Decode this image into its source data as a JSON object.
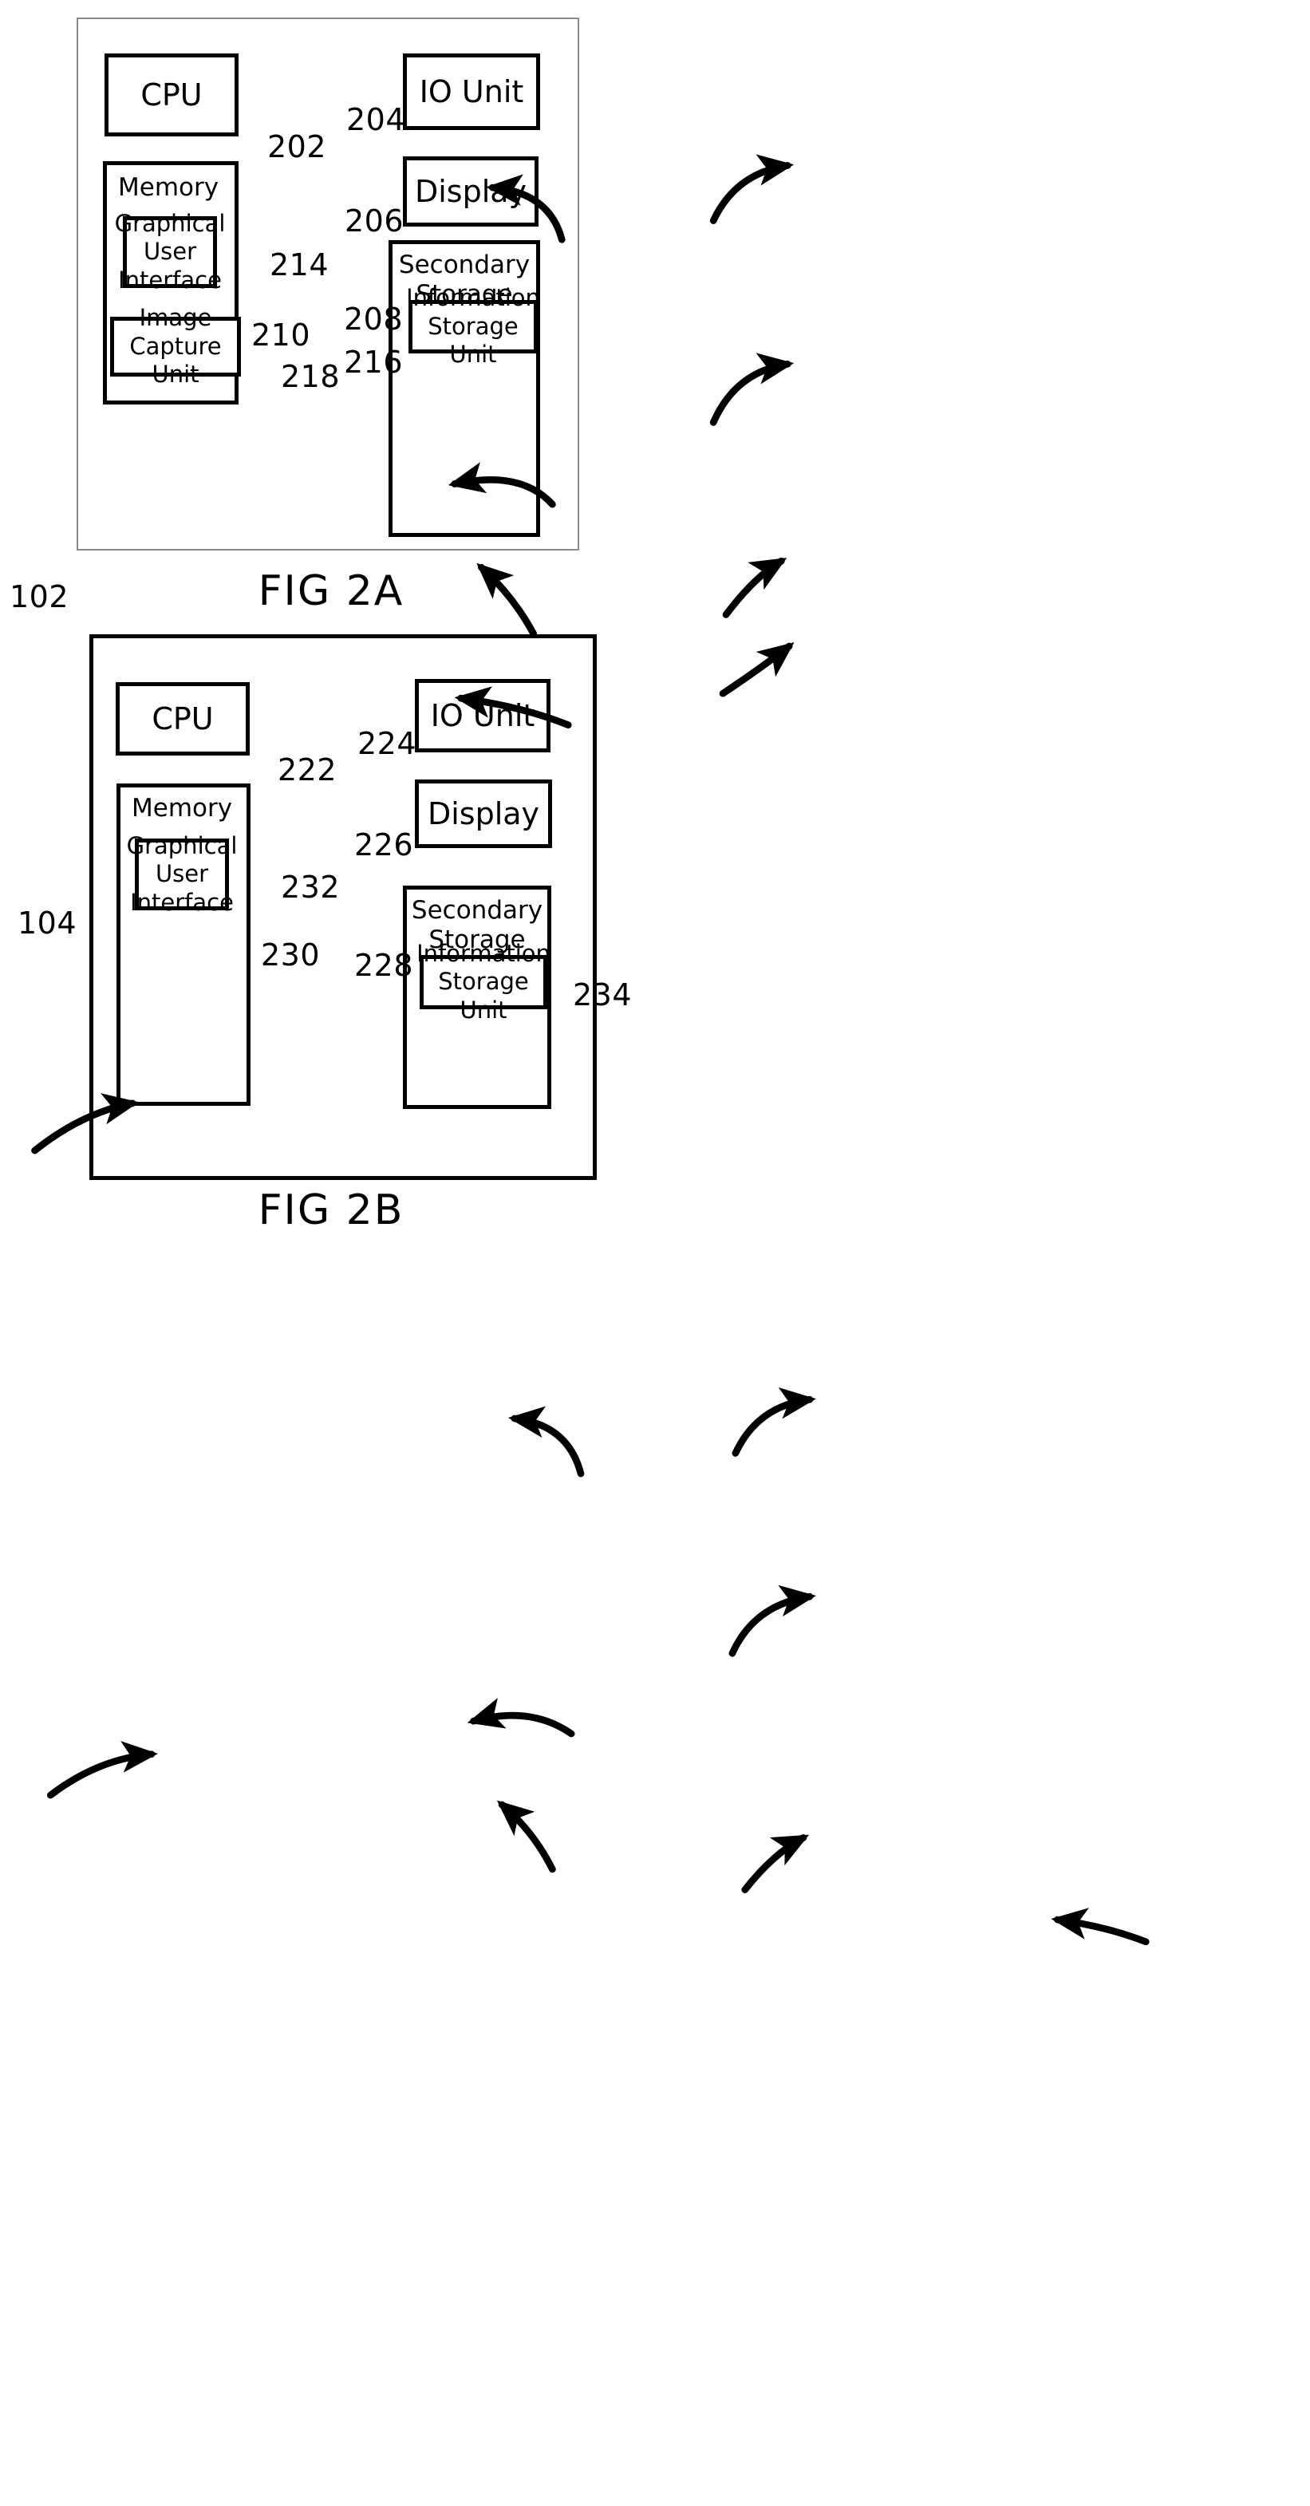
{
  "document": {
    "type": "patent-drawing-sheet",
    "figures": [
      "FIG 2A",
      "FIG 2B"
    ]
  },
  "figure_a": {
    "caption": "FIG 2A",
    "system_ref": "102",
    "boxes": {
      "cpu": {
        "label": "CPU",
        "ref": "202"
      },
      "memory": {
        "label": "Memory",
        "ref": "210"
      },
      "gui": {
        "label": "Graphical\nUser\nInterface",
        "line1": "Graphical",
        "line2": "User",
        "line3": "Interface",
        "ref": "214"
      },
      "image_capture": {
        "label": "Image Capture\nUnit",
        "line1": "Image Capture",
        "line2": "Unit",
        "ref": "218"
      },
      "io_unit": {
        "label": "IO Unit",
        "ref": "204"
      },
      "display": {
        "label": "Display",
        "ref": "206"
      },
      "secondary_storage": {
        "line1": "Secondary",
        "line2": "Storage",
        "ref": "208"
      },
      "information_storage": {
        "line1": "Information",
        "line2": "Storage Unit",
        "ref": "216"
      }
    }
  },
  "figure_b": {
    "caption": "FIG 2B",
    "system_ref": "104",
    "boxes": {
      "cpu": {
        "label": "CPU",
        "ref": "222"
      },
      "memory": {
        "label": "Memory",
        "ref": "230"
      },
      "gui": {
        "line1": "Graphical",
        "line2": "User",
        "line3": "Interface",
        "ref": "232"
      },
      "io_unit": {
        "label": "IO Unit",
        "ref": "224"
      },
      "display": {
        "label": "Display",
        "ref": "226"
      },
      "secondary_storage": {
        "line1": "Secondary",
        "line2": "Storage",
        "ref": "228"
      },
      "information_storage": {
        "line1": "Information",
        "line2": "Storage Unit",
        "ref": "234"
      }
    }
  },
  "colors": {
    "ink": "#000000",
    "paper": "#ffffff",
    "thin_frame": "#8a8a8a"
  }
}
